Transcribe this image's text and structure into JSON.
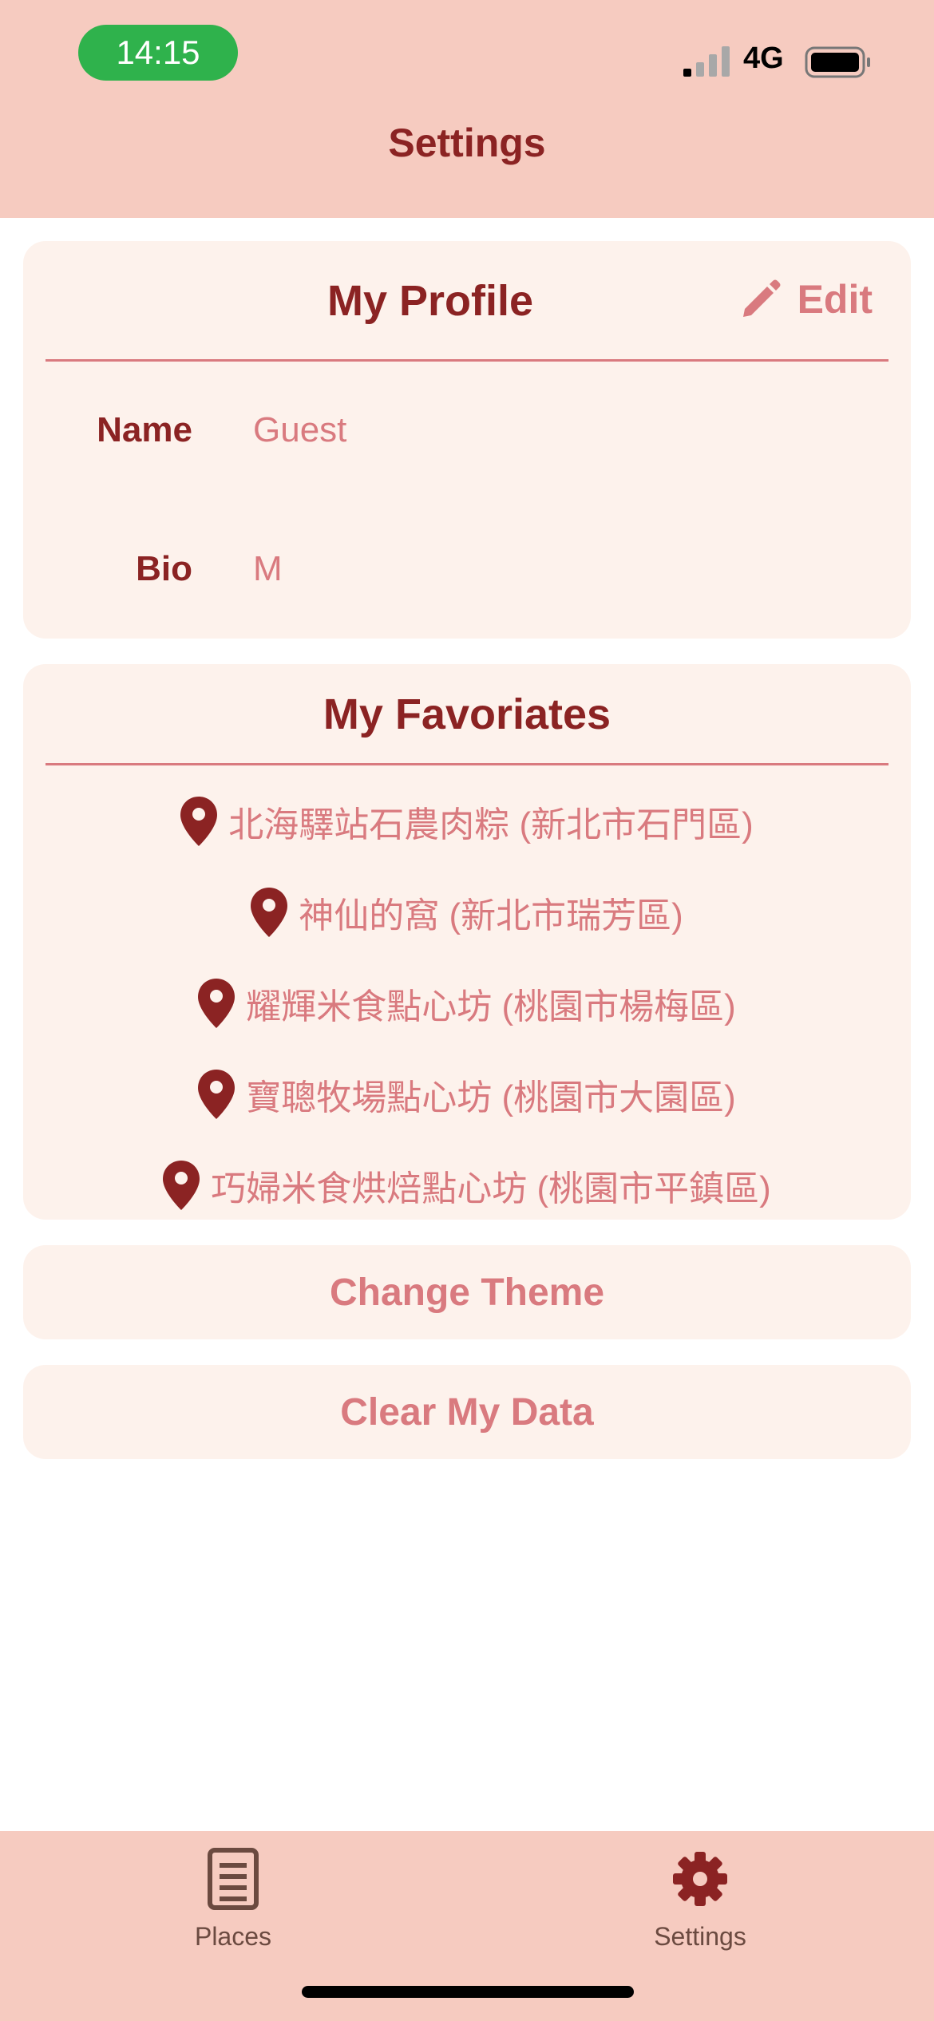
{
  "status": {
    "time": "14:15",
    "network": "4G"
  },
  "nav": {
    "title": "Settings"
  },
  "profile": {
    "title": "My Profile",
    "edit_label": "Edit",
    "name_label": "Name",
    "name_value": "Guest",
    "bio_label": "Bio",
    "bio_value": "M"
  },
  "favorites": {
    "title": "My Favoriates",
    "items": [
      "北海驛站石農肉粽 (新北市石門區)",
      "神仙的窩 (新北市瑞芳區)",
      "耀輝米食點心坊 (桃園市楊梅區)",
      "寶聰牧場點心坊 (桃園市大園區)",
      "巧婦米食烘焙點心坊 (桃園市平鎮區)"
    ]
  },
  "actions": {
    "change_theme": "Change Theme",
    "clear_data": "Clear My Data"
  },
  "tabs": [
    {
      "label": "Places",
      "icon": "document-icon"
    },
    {
      "label": "Settings",
      "icon": "gear-icon"
    }
  ],
  "colors": {
    "header_bg": "#f6cbc0",
    "card_bg": "#fdf2ec",
    "primary": "#8b2323",
    "accent": "#d97a7f"
  }
}
